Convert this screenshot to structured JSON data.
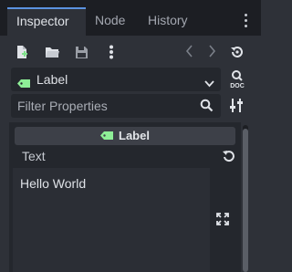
{
  "tabs": [
    {
      "label": "Inspector",
      "active": true
    },
    {
      "label": "Node",
      "active": false
    },
    {
      "label": "History",
      "active": false
    }
  ],
  "toolbar": {
    "icons": [
      "new-resource-icon",
      "load-folder-icon",
      "save-icon",
      "more-options-icon",
      "back-chevron-icon",
      "forward-chevron-icon",
      "history-icon"
    ]
  },
  "object_selector": {
    "value": "Label",
    "type_icon": "label-tag-icon",
    "doc_icon": "DOC"
  },
  "filter": {
    "placeholder": "Filter Properties",
    "value": ""
  },
  "section": {
    "title": "Label"
  },
  "property": {
    "name": "Text",
    "value": "Hello World"
  },
  "colors": {
    "accent": "#5b93e0",
    "label_icon": "#8eef97",
    "background": "#2e3138",
    "panel": "#24272d"
  }
}
